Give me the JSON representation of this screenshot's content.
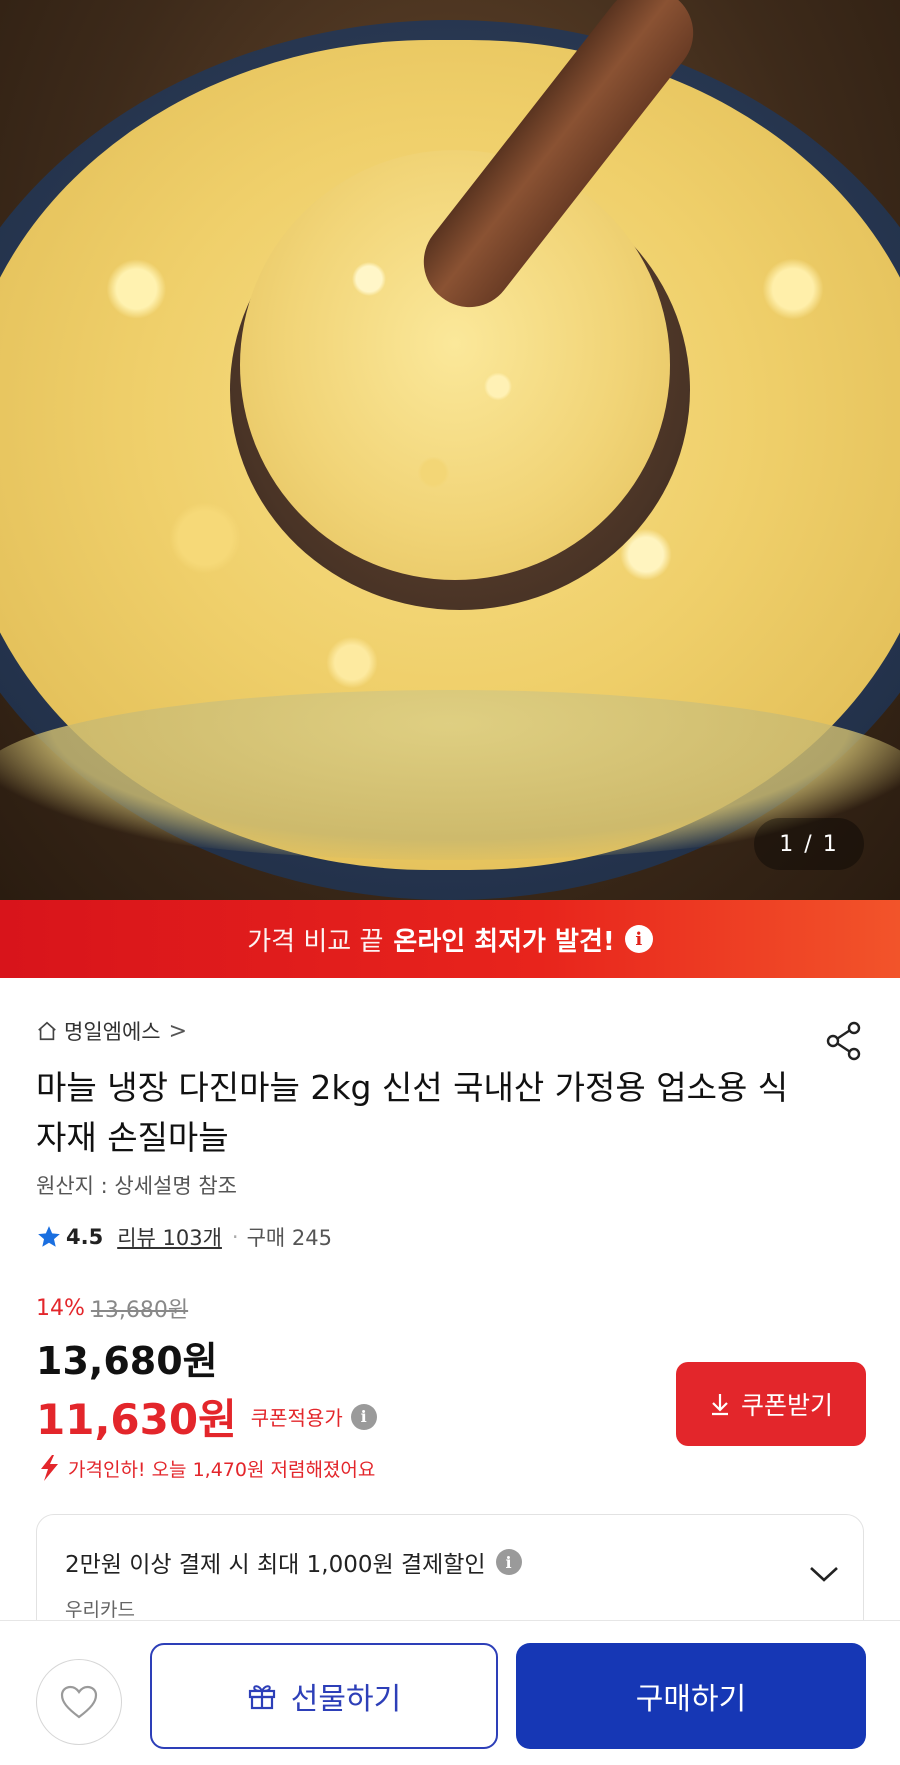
{
  "hero": {
    "image_counter": "1 / 1"
  },
  "banner": {
    "text_light": "가격 비교 끝",
    "text_bold": "온라인 최저가 발견!",
    "info_glyph": "i"
  },
  "store": {
    "name": "명일엠에스",
    "chevron": ">"
  },
  "product": {
    "title": "마늘 냉장 다진마늘 2kg 신선 국내산 가정용 업소용 식자재 손질마늘",
    "origin": "원산지 : 상세설명 참조",
    "rating": "4.5",
    "reviews": "리뷰 103개",
    "separator": "·",
    "purchases": "구매 245"
  },
  "price": {
    "discount_pct": "14%",
    "original": "13,680원",
    "current": "13,680원",
    "coupon_price": "11,630원",
    "coupon_applied_label": "쿠폰적용가",
    "coupon_button": "쿠폰받기",
    "price_drop": "가격인하! 오늘 1,470원 저렴해졌어요"
  },
  "card_promo": {
    "text": "2만원 이상 결제 시 최대 1,000원 결제할인",
    "card_name": "우리카드"
  },
  "bottom_bar": {
    "gift_label": "선물하기",
    "buy_label": "구매하기"
  },
  "colors": {
    "accent_red": "#e3262b",
    "accent_blue": "#1637b5",
    "star_blue": "#1a6fe0"
  }
}
